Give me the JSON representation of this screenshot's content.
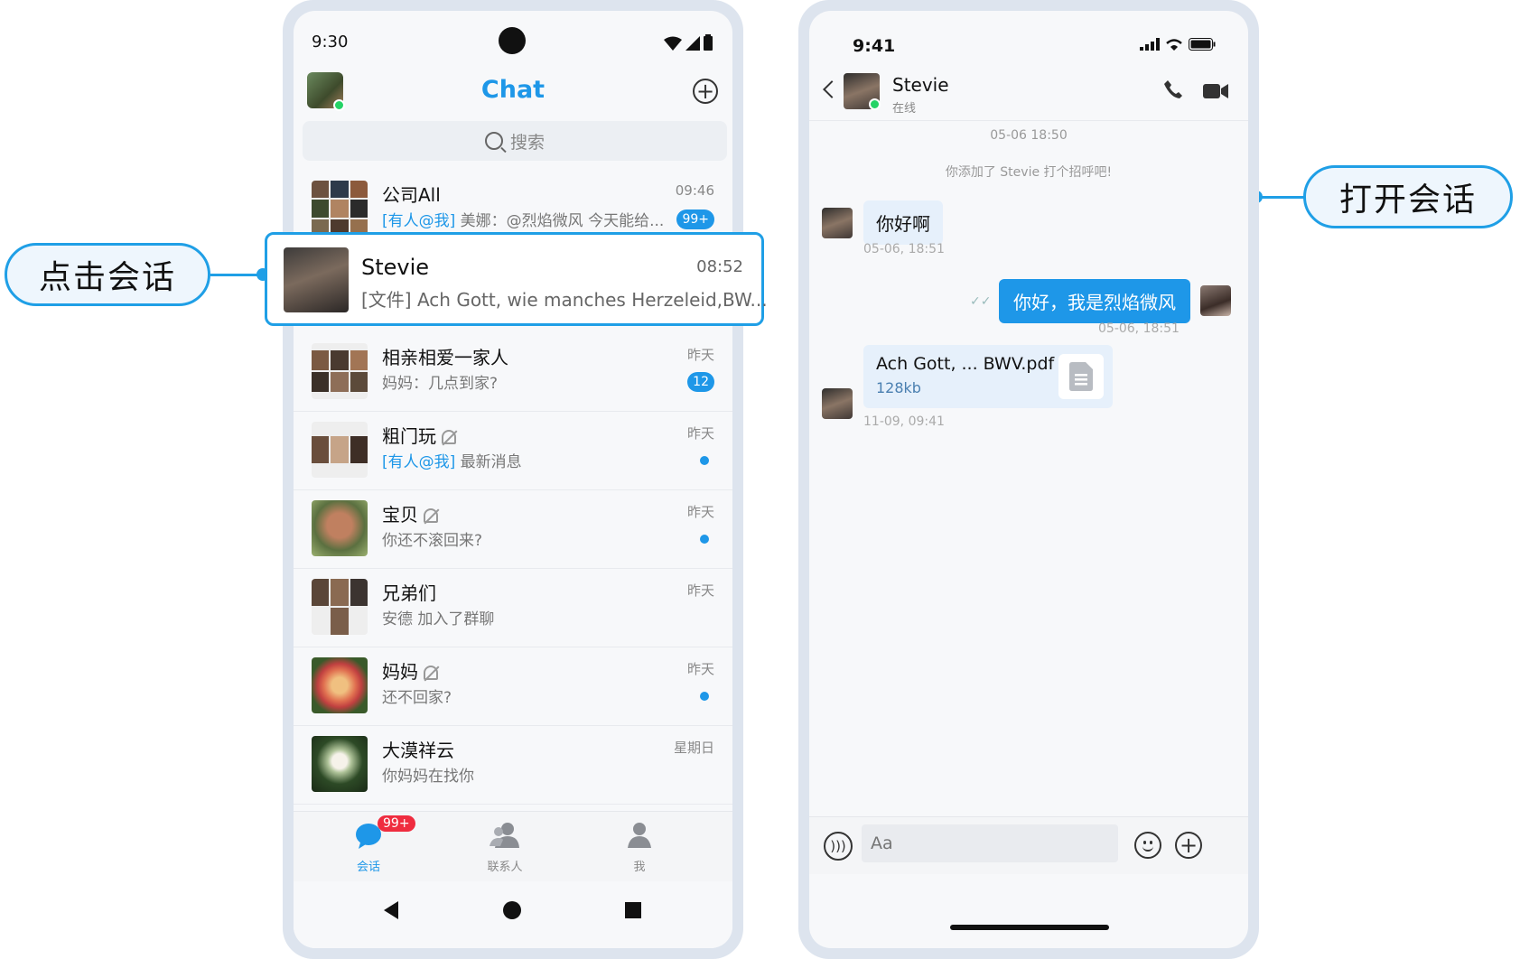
{
  "callouts": {
    "left_label": "点击会话",
    "right_label": "打开会话"
  },
  "left_phone": {
    "status_time": "9:30",
    "title": "Chat",
    "search_placeholder": "搜索",
    "conversations": [
      {
        "name": "公司All",
        "message_at": "[有人@我]",
        "message": " 美娜：@烈焰微风 今天能给...",
        "time": "09:46",
        "badge": "99+"
      },
      {
        "name": "相亲相爱一家人",
        "message": "妈妈：几点到家?",
        "time": "昨天",
        "badge": "12"
      },
      {
        "name": "粗门玩",
        "message_at": "[有人@我]",
        "message": " 最新消息",
        "time": "昨天",
        "muted": true,
        "dot": true
      },
      {
        "name": "宝贝",
        "message": "你还不滚回来?",
        "time": "昨天",
        "muted": true,
        "dot": true
      },
      {
        "name": "兄弟们",
        "message": "安德 加入了群聊",
        "time": "昨天"
      },
      {
        "name": "妈妈",
        "message": "还不回家?",
        "time": "昨天",
        "muted": true,
        "dot": true
      },
      {
        "name": "大漠祥云",
        "message": "你妈妈在找你",
        "time": "星期日"
      }
    ],
    "selected": {
      "name": "Stevie",
      "message": "[文件] Ach Gott, wie manches Herzeleid,BW...",
      "time": "08:52"
    },
    "tabs": {
      "conversations": "会话",
      "contacts": "联系人",
      "me": "我",
      "conversations_badge": "99+"
    }
  },
  "right_phone": {
    "status_time": "9:41",
    "contact_name": "Stevie",
    "contact_status": "在线",
    "timestamp_top": "05-06 18:50",
    "system_message": "你添加了 Stevie 打个招呼吧!",
    "messages": [
      {
        "direction": "in",
        "text": "你好啊",
        "time": "05-06, 18:51"
      },
      {
        "direction": "out",
        "text": "你好，我是烈焰微风",
        "time": "05-06, 18:51"
      }
    ],
    "file": {
      "name": "Ach Gott, ... BWV.pdf",
      "size": "128kb",
      "time": "11-09, 09:41"
    },
    "input_placeholder": "Aa"
  },
  "colors": {
    "accent": "#1e97e8",
    "callout_border": "#1f9fe6",
    "badge_red": "#ef2c3f",
    "online": "#25d366"
  }
}
